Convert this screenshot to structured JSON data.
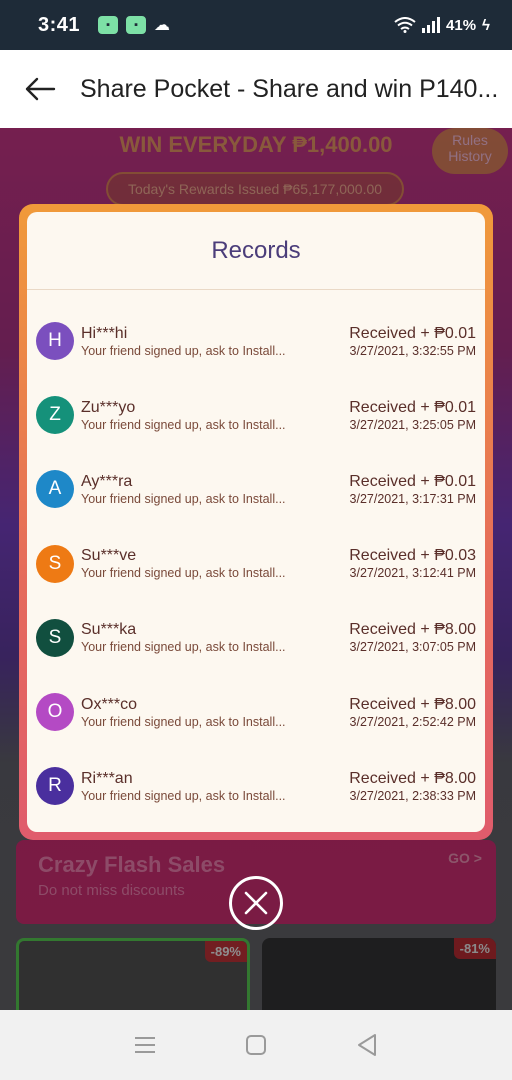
{
  "status": {
    "time": "3:41",
    "battery": "41%"
  },
  "header": {
    "title": "Share Pocket - Share and win P140..."
  },
  "background": {
    "win_everyday": "WIN EVERYDAY ₱1,400.00",
    "rules": "Rules",
    "history": "History",
    "rewards_issued": "Today's Rewards Issued ₱65,177,000.00",
    "sales_title": "Crazy Flash Sales",
    "sales_subtitle": "Do not miss discounts",
    "sales_go": "GO >",
    "discount_left": "-89%",
    "discount_right": "-81%"
  },
  "modal": {
    "title": "Records",
    "records": [
      {
        "initial": "H",
        "name": "Hi***hi",
        "desc": "Your friend signed up, ask to Install...",
        "amount": "Received + ₱0.01",
        "time": "3/27/2021, 3:32:55 PM",
        "color": "#7b4fbe"
      },
      {
        "initial": "Z",
        "name": "Zu***yo",
        "desc": "Your friend signed up, ask to Install...",
        "amount": "Received + ₱0.01",
        "time": "3/27/2021, 3:25:05 PM",
        "color": "#15917a"
      },
      {
        "initial": "A",
        "name": "Ay***ra",
        "desc": "Your friend signed up, ask to Install...",
        "amount": "Received + ₱0.01",
        "time": "3/27/2021, 3:17:31 PM",
        "color": "#1e88c8"
      },
      {
        "initial": "S",
        "name": "Su***ve",
        "desc": "Your friend signed up, ask to Install...",
        "amount": "Received + ₱0.03",
        "time": "3/27/2021, 3:12:41 PM",
        "color": "#ee7a14"
      },
      {
        "initial": "S",
        "name": "Su***ka",
        "desc": "Your friend signed up, ask to Install...",
        "amount": "Received + ₱8.00",
        "time": "3/27/2021, 3:07:05 PM",
        "color": "#114f3f"
      },
      {
        "initial": "O",
        "name": "Ox***co",
        "desc": "Your friend signed up, ask to Install...",
        "amount": "Received + ₱8.00",
        "time": "3/27/2021, 2:52:42 PM",
        "color": "#b44ac4"
      },
      {
        "initial": "R",
        "name": "Ri***an",
        "desc": "Your friend signed up, ask to Install...",
        "amount": "Received + ₱8.00",
        "time": "3/27/2021, 2:38:33 PM",
        "color": "#4a2f9e"
      }
    ]
  },
  "icons": {
    "back": "back-arrow-icon",
    "close": "close-icon",
    "nav": [
      "menu-icon",
      "home-icon",
      "back-triangle-icon"
    ]
  }
}
